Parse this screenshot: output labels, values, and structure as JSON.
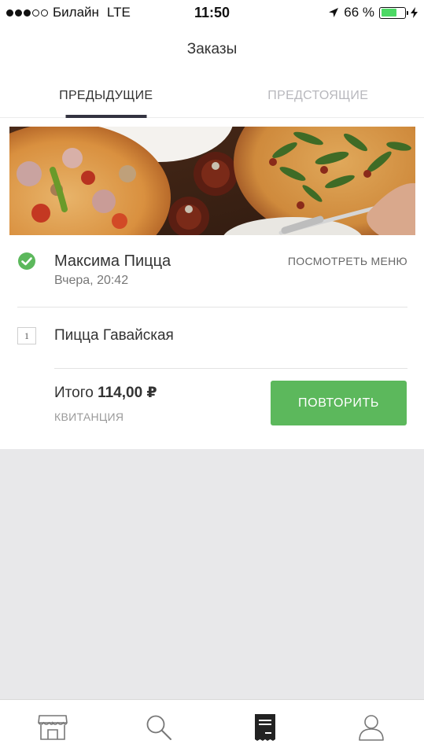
{
  "status_bar": {
    "carrier": "Билайн",
    "network": "LTE",
    "time": "11:50",
    "battery": "66 %",
    "battery_level": 0.66,
    "signal_bars": 3,
    "signal_max": 5
  },
  "header": {
    "title": "Заказы"
  },
  "tabs": [
    {
      "label": "ПРЕДЫДУЩИЕ",
      "active": true
    },
    {
      "label": "ПРЕДСТОЯЩИЕ",
      "active": false
    }
  ],
  "order": {
    "restaurant": "Максима Пицца",
    "time": "Вчера, 20:42",
    "menu_link": "ПОСМОТРЕТЬ МЕНЮ",
    "status_icon": "check-circle-icon",
    "items": [
      {
        "qty": "1",
        "name": "Пицца Гавайская"
      }
    ],
    "total_label": "Итого",
    "total_value": "114,00 ₽",
    "receipt_link": "КВИТАНЦИЯ",
    "repeat_button": "ПОВТОРИТЬ"
  },
  "bottom_nav": [
    {
      "icon": "store-icon",
      "active": false
    },
    {
      "icon": "search-icon",
      "active": false
    },
    {
      "icon": "receipt-icon",
      "active": true
    },
    {
      "icon": "profile-icon",
      "active": false
    }
  ],
  "colors": {
    "accent_green": "#5cb85c",
    "check_green": "#5cb85c",
    "battery_green": "#4cd964",
    "tab_underline": "#333340",
    "empty_background": "#e8e8ea"
  }
}
